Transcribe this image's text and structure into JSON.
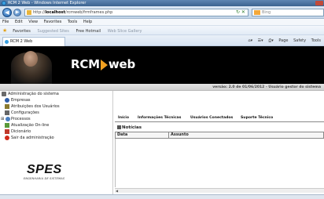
{
  "window": {
    "title": "RCM 2 Web - Windows Internet Explorer"
  },
  "address": {
    "url_prefix": "http://",
    "url_host": "localhost",
    "url_path": "/rcmweb/frmframes.php",
    "search_placeholder": "Bing"
  },
  "menubar": {
    "items": [
      "File",
      "Edit",
      "View",
      "Favorites",
      "Tools",
      "Help"
    ]
  },
  "favorites": {
    "label": "Favorites",
    "items": [
      "Suggested Sites",
      "Free Hotmail",
      "Web Slice Gallery"
    ]
  },
  "browser_tab": {
    "label": "RCM 2 Web"
  },
  "commandbar": {
    "items": [
      "Page",
      "Safety",
      "Tools"
    ]
  },
  "banner": {
    "brand_left": "RCM",
    "brand_right": "web"
  },
  "subbar": {
    "text": "versão: 2.0 de 01/06/2012 - Usuário gestor do sistema"
  },
  "sidebar": {
    "items": [
      {
        "label": "Administração do sistema",
        "icon": "admin-icon",
        "color": "#6a6a6a"
      },
      {
        "label": "Empresas",
        "icon": "company-icon",
        "color": "#2f5ea8"
      },
      {
        "label": "Atribuições dos Usuários",
        "icon": "users-icon",
        "color": "#8a7a2f"
      },
      {
        "label": "Configurações",
        "icon": "settings-icon",
        "color": "#666666"
      },
      {
        "label": "Processos",
        "icon": "process-icon",
        "color": "#4a7fc0"
      },
      {
        "label": "Atualização On-line",
        "icon": "update-icon",
        "color": "#5a9a3a"
      },
      {
        "label": "Dicionário",
        "icon": "dictionary-icon",
        "color": "#c0392b"
      },
      {
        "label": "Sair da administração",
        "icon": "exit-icon",
        "color": "#d12a1a"
      }
    ],
    "logo_text": "SPES",
    "logo_subtext": "ENGENHARIA DE SISTEMAS"
  },
  "main": {
    "tabs": [
      "Início",
      "Informações Técnicas",
      "Usuários Conectados",
      "Suporte Técnico"
    ],
    "news_title": "Notícias",
    "columns": [
      "Data",
      "Assunto"
    ]
  }
}
